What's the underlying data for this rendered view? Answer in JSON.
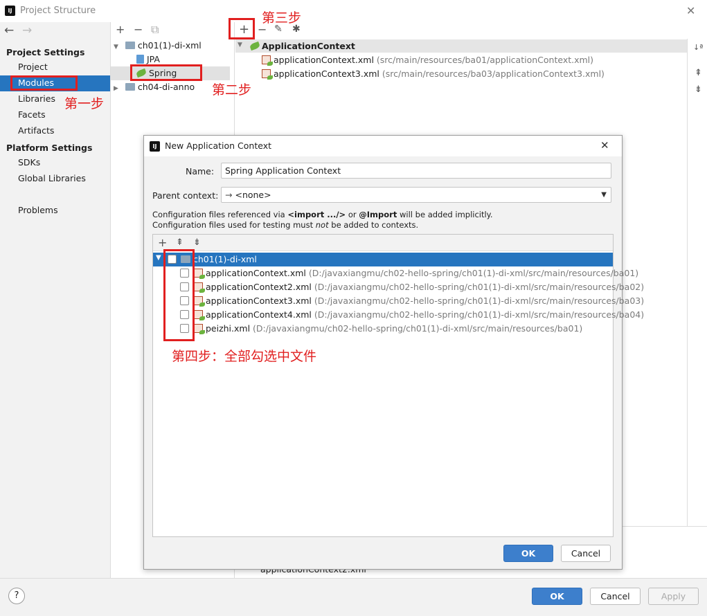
{
  "window": {
    "title": "Project Structure",
    "logo": "IJ"
  },
  "nav": {
    "back_glyph": "←",
    "forward_glyph": "→",
    "project_settings_header": "Project Settings",
    "project_items": [
      "Project",
      "Modules",
      "Libraries",
      "Facets",
      "Artifacts"
    ],
    "platform_settings_header": "Platform Settings",
    "platform_items": [
      "SDKs",
      "Global Libraries"
    ],
    "problems": "Problems",
    "selected": "Modules"
  },
  "modules": {
    "toolbar": [
      "+",
      "−",
      "⧉"
    ],
    "tree": [
      {
        "label": "ch01(1)-di-xml",
        "expanded": true
      },
      {
        "label": "JPA"
      },
      {
        "label": "Spring",
        "selected": true
      },
      {
        "label": "ch04-di-anno",
        "expanded": false
      }
    ]
  },
  "context_panel": {
    "toolbar": [
      "+",
      "−"
    ],
    "header": "ApplicationContext",
    "files": [
      {
        "name": "applicationContext.xml",
        "path": "(src/main/resources/ba01/applicationContext.xml)"
      },
      {
        "name": "applicationContext3.xml",
        "path": "(src/main/resources/ba03/applicationContext3.xml)"
      }
    ],
    "bottom_hint": "applicationContext2.xml",
    "side_tools": [
      "↓ª",
      "⇞",
      "⇟"
    ]
  },
  "dialog": {
    "title": "New Application Context",
    "name_label": "Name:",
    "name_value": "Spring Application Context",
    "parent_label": "Parent context:",
    "parent_value": "<none>",
    "info_line1_a": "Configuration files referenced via ",
    "info_line1_b": "<import .../>",
    "info_line1_c": " or ",
    "info_line1_d": "@Import",
    "info_line1_e": " will be added implicitly.",
    "info_line2_a": "Configuration files used for testing must ",
    "info_line2_b": "not",
    "info_line2_c": " be added to contexts.",
    "tree_toolbar": [
      "+",
      "⇞",
      "⇟"
    ],
    "root": "ch01(1)-di-xml",
    "files": [
      {
        "name": "applicationContext.xml",
        "path": "(D:/javaxiangmu/ch02-hello-spring/ch01(1)-di-xml/src/main/resources/ba01)"
      },
      {
        "name": "applicationContext2.xml",
        "path": "(D:/javaxiangmu/ch02-hello-spring/ch01(1)-di-xml/src/main/resources/ba02)"
      },
      {
        "name": "applicationContext3.xml",
        "path": "(D:/javaxiangmu/ch02-hello-spring/ch01(1)-di-xml/src/main/resources/ba03)"
      },
      {
        "name": "applicationContext4.xml",
        "path": "(D:/javaxiangmu/ch02-hello-spring/ch01(1)-di-xml/src/main/resources/ba04)"
      },
      {
        "name": "peizhi.xml",
        "path": "(D:/javaxiangmu/ch02-hello-spring/ch01(1)-di-xml/src/main/resources/ba01)"
      }
    ],
    "ok": "OK",
    "cancel": "Cancel"
  },
  "footer": {
    "help": "?",
    "ok": "OK",
    "cancel": "Cancel",
    "apply": "Apply"
  },
  "annotations": {
    "step1": "第一步",
    "step2": "第二步",
    "step3": "第三步",
    "step4": "第四步：全部勾选中文件",
    "color": "#e11f1f"
  }
}
